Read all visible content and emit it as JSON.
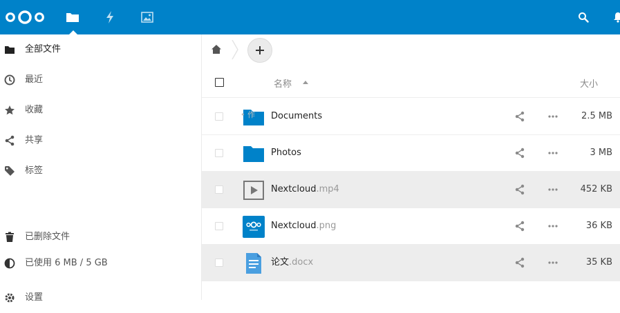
{
  "header": {
    "apps": [
      {
        "icon": "folder-icon",
        "active": true
      },
      {
        "icon": "activity-icon"
      },
      {
        "icon": "gallery-icon"
      }
    ],
    "right_icons": [
      "search-icon",
      "notifications-icon"
    ],
    "brand_color": "#0082c9"
  },
  "sidebar": {
    "items": [
      {
        "label": "全部文件",
        "icon": "folder-icon",
        "active": true
      },
      {
        "label": "最近",
        "icon": "clock-icon"
      },
      {
        "label": "收藏",
        "icon": "star-icon"
      },
      {
        "label": "共享",
        "icon": "share-icon"
      },
      {
        "label": "标签",
        "icon": "tag-icon"
      }
    ],
    "bottom": [
      {
        "label": "已删除文件",
        "icon": "trash-icon"
      },
      {
        "label": "已使用 6 MB / 5 GB",
        "icon": "quota-icon"
      },
      {
        "label": "设置",
        "icon": "gear-icon"
      }
    ]
  },
  "files": {
    "columns": {
      "name": "名称",
      "size": "大小"
    },
    "rows": [
      {
        "base": "Documents",
        "ext": "",
        "type": "folder",
        "size": "2.5 MB",
        "highlight": false,
        "ghost": "• 作"
      },
      {
        "base": "Photos",
        "ext": "",
        "type": "folder",
        "size": "3 MB",
        "highlight": false
      },
      {
        "base": "Nextcloud",
        "ext": ".mp4",
        "type": "video",
        "size": "452 KB",
        "highlight": true
      },
      {
        "base": "Nextcloud",
        "ext": ".png",
        "type": "image",
        "size": "36 KB",
        "highlight": false
      },
      {
        "base": "论文",
        "ext": ".docx",
        "type": "document",
        "size": "35 KB",
        "highlight": true
      }
    ]
  }
}
